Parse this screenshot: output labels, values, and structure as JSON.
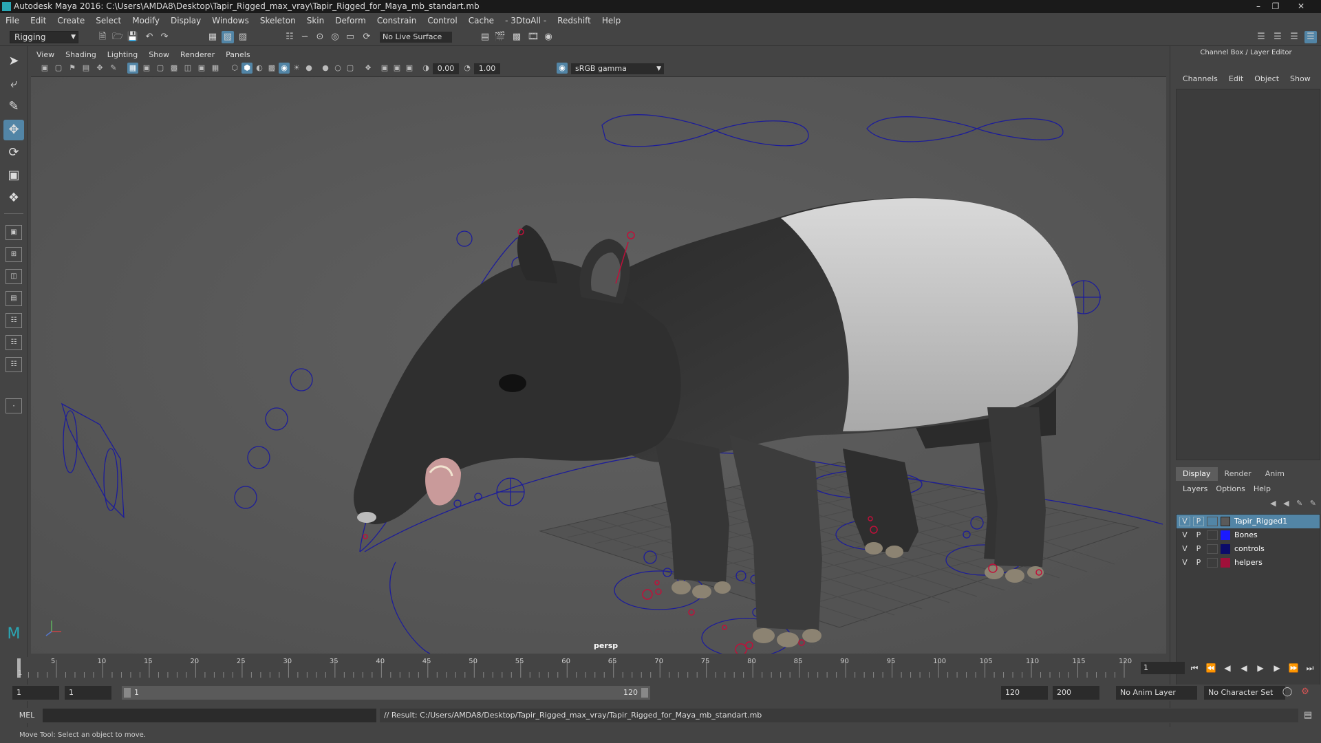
{
  "window": {
    "title": "Autodesk Maya 2016: C:\\Users\\AMDA8\\Desktop\\Tapir_Rigged_max_vray\\Tapir_Rigged_for_Maya_mb_standart.mb"
  },
  "menubar": {
    "items": [
      "File",
      "Edit",
      "Create",
      "Select",
      "Modify",
      "Display",
      "Windows",
      "Skeleton",
      "Skin",
      "Deform",
      "Constrain",
      "Control",
      "Cache",
      "- 3DtoAll -",
      "Redshift",
      "Help"
    ]
  },
  "shelf": {
    "mode": "Rigging",
    "live_surface": "No Live Surface"
  },
  "viewport": {
    "menu": [
      "View",
      "Shading",
      "Lighting",
      "Show",
      "Renderer",
      "Panels"
    ],
    "exposure": "0.00",
    "gamma": "1.00",
    "color_space": "sRGB gamma",
    "camera": "persp"
  },
  "channel_box": {
    "title": "Channel Box / Layer Editor",
    "menu": [
      "Channels",
      "Edit",
      "Object",
      "Show"
    ]
  },
  "layer_editor": {
    "tabs": [
      "Display",
      "Render",
      "Anim"
    ],
    "menu": [
      "Layers",
      "Options",
      "Help"
    ],
    "layers": [
      {
        "v": "V",
        "p": "P",
        "name": "Tapir_Rigged1",
        "color": "#5a5a5a",
        "selected": true
      },
      {
        "v": "V",
        "p": "P",
        "name": "Bones",
        "color": "#1a1aff",
        "selected": false
      },
      {
        "v": "V",
        "p": "P",
        "name": "controls",
        "color": "#0b0b6a",
        "selected": false
      },
      {
        "v": "V",
        "p": "P",
        "name": "helpers",
        "color": "#a0103a",
        "selected": false
      }
    ]
  },
  "timeline": {
    "ticks": [
      "1",
      "5",
      "10",
      "15",
      "20",
      "25",
      "30",
      "35",
      "40",
      "45",
      "50",
      "55",
      "60",
      "65",
      "70",
      "75",
      "80",
      "85",
      "90",
      "95",
      "100",
      "105",
      "110",
      "115",
      "120"
    ],
    "current_frame": "1"
  },
  "range": {
    "start": "1",
    "playback_start": "1",
    "slider_start": "1",
    "slider_end": "120",
    "playback_end": "120",
    "end": "200",
    "anim_layer": "No Anim Layer",
    "character_set": "No Character Set"
  },
  "command_line": {
    "label": "MEL",
    "result": "// Result: C:/Users/AMDA8/Desktop/Tapir_Rigged_max_vray/Tapir_Rigged_for_Maya_mb_standart.mb"
  },
  "status": {
    "help_text": "Move Tool: Select an object to move."
  },
  "colors": {
    "accent": "#5285a6",
    "rig_blue": "#1c1c9a",
    "rig_red": "#c0103a"
  }
}
